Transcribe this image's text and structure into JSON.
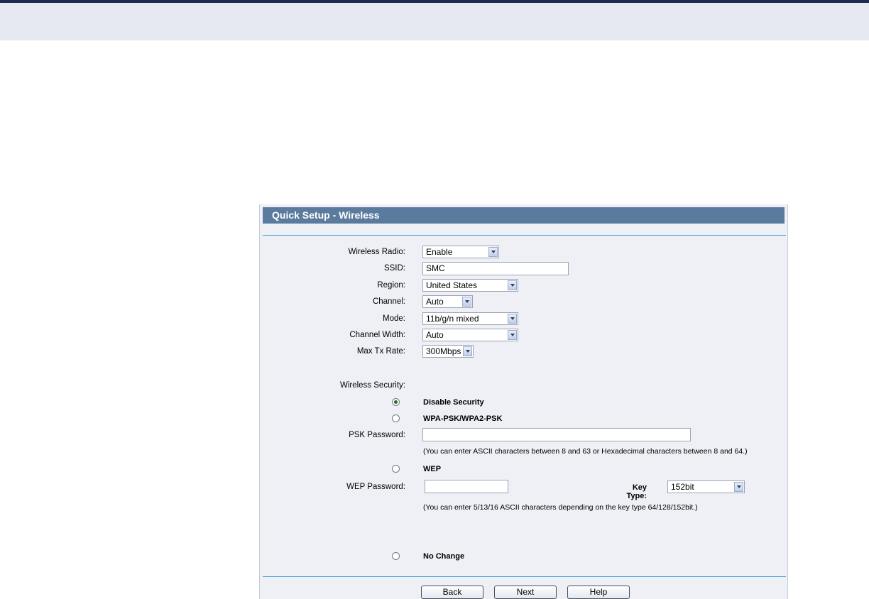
{
  "header": {
    "title": "Quick Setup - Wireless"
  },
  "fields": {
    "wireless_radio": {
      "label": "Wireless Radio:",
      "value": "Enable"
    },
    "ssid": {
      "label": "SSID:",
      "value": "SMC"
    },
    "region": {
      "label": "Region:",
      "value": "United States"
    },
    "channel": {
      "label": "Channel:",
      "value": "Auto"
    },
    "mode": {
      "label": "Mode:",
      "value": "11b/g/n mixed"
    },
    "channel_width": {
      "label": "Channel Width:",
      "value": "Auto"
    },
    "max_tx_rate": {
      "label": "Max Tx Rate:",
      "value": "300Mbps"
    }
  },
  "security": {
    "label": "Wireless Security:",
    "options": {
      "disable": {
        "label": "Disable Security",
        "checked": true
      },
      "wpa": {
        "label": "WPA-PSK/WPA2-PSK",
        "checked": false
      },
      "wep": {
        "label": "WEP",
        "checked": false
      },
      "nochange": {
        "label": "No Change",
        "checked": false
      }
    },
    "psk_password": {
      "label": "PSK Password:",
      "value": ""
    },
    "psk_note": "(You can enter ASCII characters between 8 and 63 or Hexadecimal characters between 8 and 64.)",
    "wep_password": {
      "label": "WEP Password:",
      "value": ""
    },
    "key_type": {
      "label": "Key Type:",
      "value": "152bit"
    },
    "wep_note": "(You can enter 5/13/16 ASCII characters depending on the key type 64/128/152bit.)"
  },
  "buttons": {
    "back": "Back",
    "next": "Next",
    "help": "Help"
  },
  "colors": {
    "header_bg": "#5a7b9e",
    "panel_bg": "#eef0f6",
    "rule": "#4aa0d8"
  }
}
